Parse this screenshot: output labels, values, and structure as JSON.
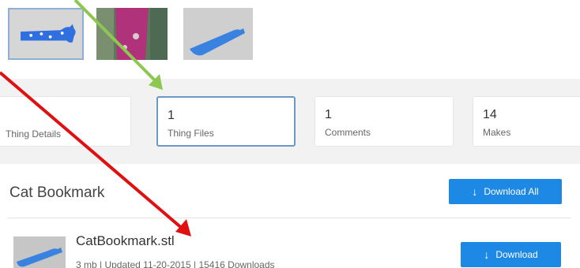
{
  "thumbnails": [
    {
      "name": "thumb-bookmark-top-view",
      "selected": true
    },
    {
      "name": "thumb-bookmark-photo",
      "selected": false
    },
    {
      "name": "thumb-bookmark-3d-view",
      "selected": false
    }
  ],
  "stats": {
    "details": {
      "label": "Thing Details"
    },
    "files": {
      "count": "1",
      "label": "Thing Files"
    },
    "comments": {
      "count": "1",
      "label": "Comments"
    },
    "makes": {
      "count": "14",
      "label": "Makes"
    }
  },
  "files_section": {
    "title": "Cat Bookmark",
    "download_all_label": "Download All",
    "download_icon": "download-arrow-icon"
  },
  "file": {
    "name": "CatBookmark.stl",
    "meta": "3 mb | Updated 11-20-2015 | 15416 Downloads",
    "download_label": "Download"
  },
  "annotations": {
    "green_arrow_color": "#8cc850",
    "red_arrow_color": "#e01010"
  },
  "colors": {
    "accent": "#1e88e5",
    "active_border": "#6d97c4"
  }
}
